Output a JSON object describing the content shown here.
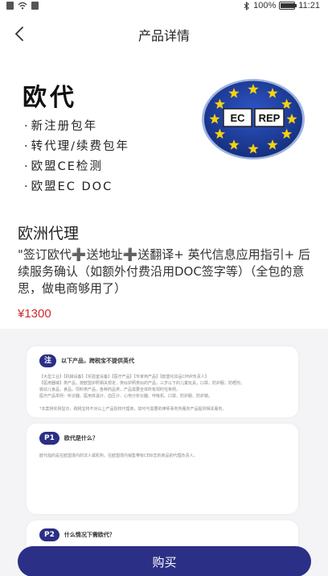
{
  "status_bar": {
    "battery": "100%",
    "battery_level": 1.0,
    "time": "11:21"
  },
  "nav": {
    "title": "产品详情",
    "back_icon": "chevron-left-icon"
  },
  "hero": {
    "title": "欧代",
    "features": [
      "新注册包年",
      "转代理/续费包年",
      "欧盟CE检测",
      "欧盟EC DOC"
    ],
    "badge": {
      "left_text": "EC",
      "right_text": "REP",
      "colors": {
        "background": "#1e3e9e",
        "stars": "#f5d20f"
      }
    }
  },
  "product": {
    "name": "欧洲代理",
    "description": "\"签订欧代➕送地址➕送翻译+ 英代信息应用指引+ 后续服务确认（如额外付费沿用DOC签字等）（全包的意思，做电商够用了）",
    "price": "¥1300"
  },
  "info_cards": [
    {
      "pill": "注",
      "title": "以下产品，跨税宝不提供英代",
      "lines": [
        "【大型工业】【机械设备】【实验室设备】【医疗产品】【专家用产品】【欧盟化妆品CPNP负责人】",
        "【医用器械】类产品，按欧盟护照相关规定，类似护照类似的产品，三岁以下的儿童玩具，口罩，防护服，防晒剂，",
        "婴幼儿食品，食品，饲料类产品，各种药品类，产品需要全体所有现时任条例，",
        "医疗产品举例：听诊器、医用体温计、血压计、心电分析仪器、呼吸机、口罩、防护服、防护镜。"
      ],
      "note": "*本案例实例显示，跨税宝将不对以上产品授权代理商，如可与需要的律师事务所服务产品提供相关服务。"
    },
    {
      "pill": "P1",
      "title": "欧代是什么？",
      "lines": [
        "欧代指的是在欧盟境内的法人或机构，在欧盟境内销售带有CE标志的商品的代理负责人。"
      ]
    },
    {
      "pill": "P2",
      "title": "什么情况下需欧代？",
      "lines": []
    }
  ],
  "buy_button": {
    "label": "购买"
  },
  "colors": {
    "accent": "#2b2f86",
    "price": "#d02a2a"
  }
}
